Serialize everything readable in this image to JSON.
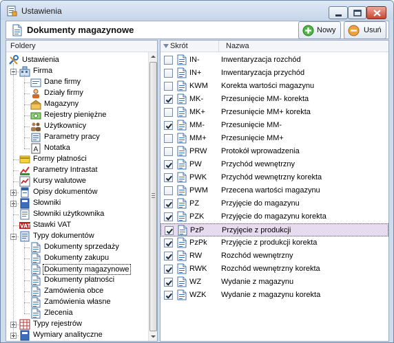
{
  "window": {
    "title": "Ustawienia"
  },
  "header": {
    "title": "Dokumenty magazynowe"
  },
  "toolbar": {
    "new_label": "Nowy",
    "delete_label": "Usuń"
  },
  "folders": {
    "header": "Foldery",
    "items": [
      {
        "label": "Ustawienia",
        "level": 0,
        "expander": "none",
        "icon": "settings-icon"
      },
      {
        "label": "Firma",
        "level": 1,
        "expander": "minus",
        "icon": "company-icon"
      },
      {
        "label": "Dane firmy",
        "level": 2,
        "expander": "none",
        "icon": "company-data-icon"
      },
      {
        "label": "Działy firmy",
        "level": 2,
        "expander": "none",
        "icon": "departments-icon"
      },
      {
        "label": "Magazyny",
        "level": 2,
        "expander": "none",
        "icon": "warehouse-icon"
      },
      {
        "label": "Rejestry pieniężne",
        "level": 2,
        "expander": "none",
        "icon": "money-registers-icon"
      },
      {
        "label": "Użytkownicy",
        "level": 2,
        "expander": "none",
        "icon": "users-icon"
      },
      {
        "label": "Parametry pracy",
        "level": 2,
        "expander": "none",
        "icon": "work-parameters-icon"
      },
      {
        "label": "Notatka",
        "level": 2,
        "expander": "none",
        "icon": "note-icon"
      },
      {
        "label": "Formy płatności",
        "level": 1,
        "expander": "none",
        "icon": "payment-forms-icon"
      },
      {
        "label": "Parametry Intrastat",
        "level": 1,
        "expander": "none",
        "icon": "intrastat-icon"
      },
      {
        "label": "Kursy walutowe",
        "level": 1,
        "expander": "none",
        "icon": "exchange-rates-icon"
      },
      {
        "label": "Opisy dokumentów",
        "level": 1,
        "expander": "plus",
        "icon": "document-descriptions-icon"
      },
      {
        "label": "Słowniki",
        "level": 1,
        "expander": "plus",
        "icon": "dictionaries-icon"
      },
      {
        "label": "Słowniki użytkownika",
        "level": 1,
        "expander": "none",
        "icon": "user-dictionaries-icon"
      },
      {
        "label": "Stawki VAT",
        "level": 1,
        "expander": "none",
        "icon": "vat-icon"
      },
      {
        "label": "Typy dokumentów",
        "level": 1,
        "expander": "minus",
        "icon": "document-types-icon"
      },
      {
        "label": "Dokumenty sprzedaży",
        "level": 2,
        "expander": "none",
        "icon": "document-icon"
      },
      {
        "label": "Dokumenty zakupu",
        "level": 2,
        "expander": "none",
        "icon": "document-icon"
      },
      {
        "label": "Dokumenty magazynowe",
        "level": 2,
        "expander": "none",
        "icon": "document-icon",
        "selected": true
      },
      {
        "label": "Dokumenty płatności",
        "level": 2,
        "expander": "none",
        "icon": "document-icon"
      },
      {
        "label": "Zamówienia obce",
        "level": 2,
        "expander": "none",
        "icon": "document-icon"
      },
      {
        "label": "Zamówienia własne",
        "level": 2,
        "expander": "none",
        "icon": "document-icon"
      },
      {
        "label": "Zlecenia",
        "level": 2,
        "expander": "none",
        "icon": "document-icon"
      },
      {
        "label": "Typy rejestrów",
        "level": 1,
        "expander": "plus",
        "icon": "register-types-icon"
      },
      {
        "label": "Wymiary analityczne",
        "level": 1,
        "expander": "plus",
        "icon": "analytic-dimensions-icon"
      }
    ]
  },
  "documents": {
    "columns": [
      "Skrót",
      "Nazwa"
    ],
    "rows": [
      {
        "code": "IN-",
        "name": "Inwentaryzacja rozchód",
        "checked": false
      },
      {
        "code": "IN+",
        "name": "Inwentaryzacja przychód",
        "checked": false
      },
      {
        "code": "KWM",
        "name": "Korekta wartości magazynu",
        "checked": false
      },
      {
        "code": "MK-",
        "name": "Przesunięcie MM- korekta",
        "checked": true
      },
      {
        "code": "MK+",
        "name": "Przesunięcie MM+ korekta",
        "checked": false
      },
      {
        "code": "MM-",
        "name": "Przesunięcie MM-",
        "checked": true
      },
      {
        "code": "MM+",
        "name": "Przesunięcie MM+",
        "checked": false
      },
      {
        "code": "PRW",
        "name": "Protokół wprowadzenia",
        "checked": false
      },
      {
        "code": "PW",
        "name": "Przychód wewnętrzny",
        "checked": true
      },
      {
        "code": "PWK",
        "name": "Przychód wewnętrzny korekta",
        "checked": true
      },
      {
        "code": "PWM",
        "name": "Przecena wartości magazynu",
        "checked": false
      },
      {
        "code": "PZ",
        "name": "Przyjęcie do magazynu",
        "checked": true
      },
      {
        "code": "PZK",
        "name": "Przyjęcie do magazynu korekta",
        "checked": true
      },
      {
        "code": "PzP",
        "name": "Przyjęcie z produkcji",
        "checked": true,
        "selected": true
      },
      {
        "code": "PzPk",
        "name": "Przyjęcie z produkcji korekta",
        "checked": true
      },
      {
        "code": "RW",
        "name": "Rozchód wewnętrzny",
        "checked": true
      },
      {
        "code": "RWK",
        "name": "Rozchód wewnętrzny korekta",
        "checked": true
      },
      {
        "code": "WZ",
        "name": "Wydanie z magazynu",
        "checked": true
      },
      {
        "code": "WZK",
        "name": "Wydanie z magazynu korekta",
        "checked": true
      }
    ]
  },
  "colors": {
    "selected_row": "#e7dbf0",
    "window_frame": "#cfdcec",
    "close_button": "#c8452e"
  }
}
